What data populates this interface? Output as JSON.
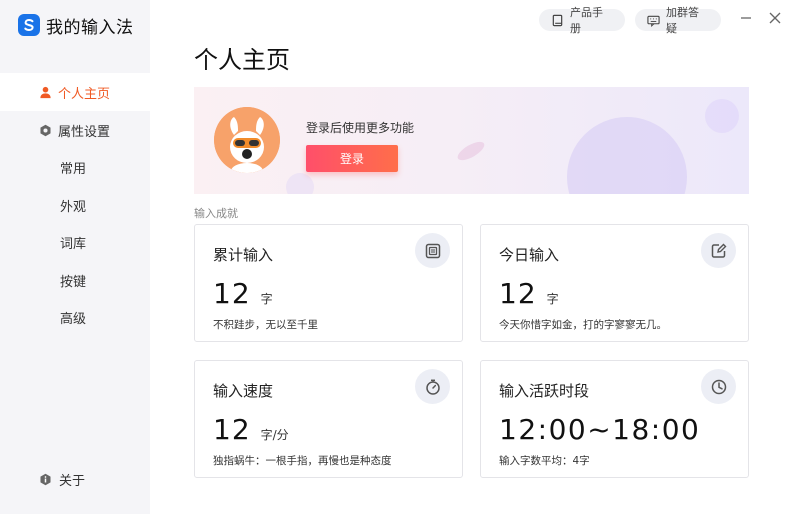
{
  "app": {
    "name": "我的输入法"
  },
  "topbar": {
    "manual": "产品手册",
    "group": "加群答疑"
  },
  "sidebar": {
    "items": [
      {
        "label": "个人主页"
      },
      {
        "label": "属性设置"
      },
      {
        "label": "常用"
      },
      {
        "label": "外观"
      },
      {
        "label": "词库"
      },
      {
        "label": "按键"
      },
      {
        "label": "高级"
      }
    ],
    "about": "关于"
  },
  "page": {
    "title": "个人主页"
  },
  "banner": {
    "message": "登录后使用更多功能",
    "login": "登录"
  },
  "section": {
    "label": "输入成就"
  },
  "cards": {
    "total": {
      "title": "累计输入",
      "value": "12",
      "unit": "字",
      "desc": "不积跬步，无以至千里"
    },
    "today": {
      "title": "今日输入",
      "value": "12",
      "unit": "字",
      "desc": "今天你惜字如金，打的字寥寥无几。"
    },
    "speed": {
      "title": "输入速度",
      "value": "12",
      "unit": "字/分",
      "desc": "独指蜗牛：一根手指，再慢也是种态度"
    },
    "active": {
      "title": "输入活跃时段",
      "value": "12:00~18:00",
      "desc": "输入字数平均：4字"
    }
  },
  "colors": {
    "accent": "#f05a24",
    "login_start": "#ff4f6a",
    "login_end": "#ff6e4a"
  }
}
